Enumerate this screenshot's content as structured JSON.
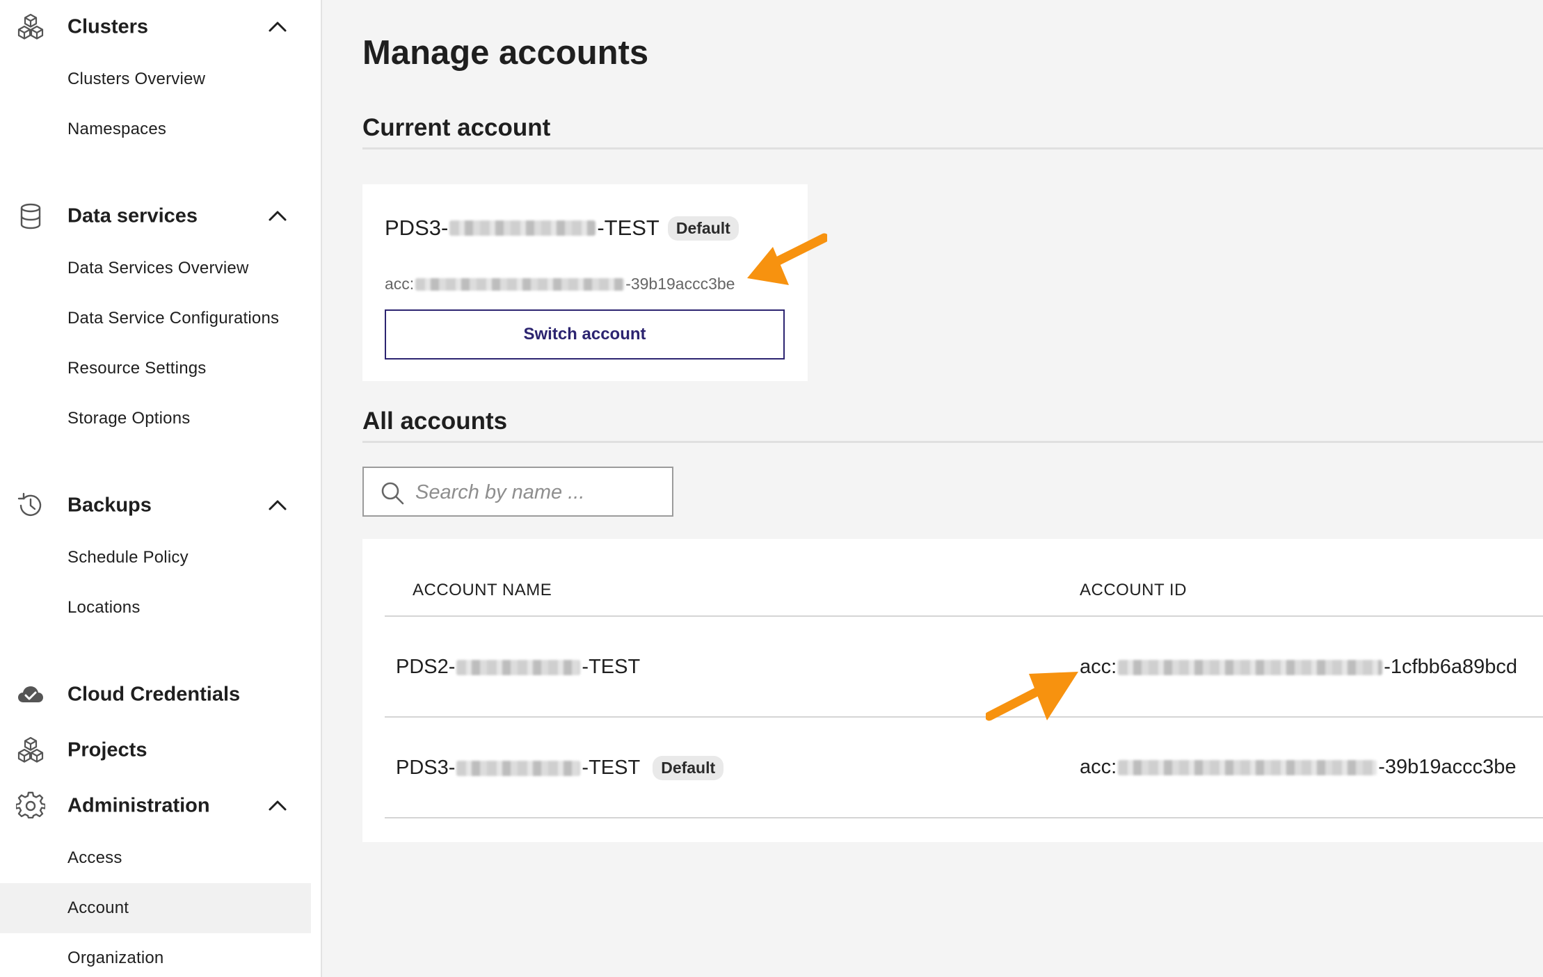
{
  "sidebar": {
    "sections": [
      {
        "label": "Clusters",
        "icon": "cubes-icon",
        "items": [
          "Clusters Overview",
          "Namespaces"
        ]
      },
      {
        "label": "Data services",
        "icon": "database-icon",
        "items": [
          "Data Services Overview",
          "Data Service Configurations",
          "Resource Settings",
          "Storage Options"
        ]
      },
      {
        "label": "Backups",
        "icon": "history-icon",
        "items": [
          "Schedule Policy",
          "Locations"
        ]
      },
      {
        "label": "Cloud Credentials",
        "icon": "cloud-check-icon"
      },
      {
        "label": "Projects",
        "icon": "cubes-icon"
      },
      {
        "label": "Administration",
        "icon": "gear-icon",
        "items": [
          "Access",
          "Account",
          "Organization"
        ]
      }
    ],
    "active_item": "Account"
  },
  "main": {
    "title": "Manage accounts",
    "current_account": {
      "section_title": "Current account",
      "name_prefix": "PDS3-",
      "name_suffix": "-TEST",
      "badge": "Default",
      "id_prefix": "acc:",
      "id_suffix": "-39b19accc3be",
      "switch_label": "Switch account"
    },
    "all_accounts": {
      "section_title": "All accounts",
      "search_placeholder": "Search by name ...",
      "columns": [
        "ACCOUNT NAME",
        "ACCOUNT ID"
      ],
      "rows": [
        {
          "name_prefix": "PDS2-",
          "name_suffix": "-TEST",
          "badge": "",
          "id_prefix": "acc:",
          "id_suffix": "-1cfbb6a89bcd"
        },
        {
          "name_prefix": "PDS3-",
          "name_suffix": "-TEST",
          "badge": "Default",
          "id_prefix": "acc:",
          "id_suffix": "-39b19accc3be"
        }
      ]
    }
  },
  "colors": {
    "accent": "#2c2470",
    "annotation_arrow": "#f7920f",
    "background": "#f4f4f4"
  }
}
